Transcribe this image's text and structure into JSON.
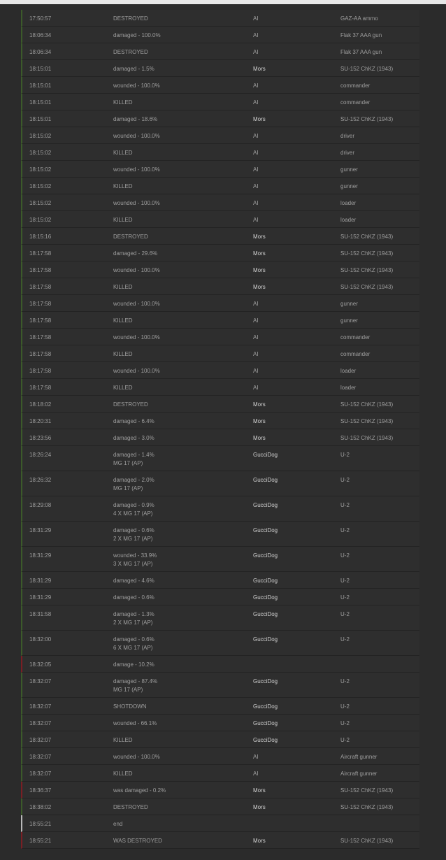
{
  "colors": {
    "background": "#2b2b2b",
    "row": "#2e2e2e",
    "border_ok": "#3c5a2a",
    "border_bad": "#7a1f24",
    "border_end": "#b9b9b9"
  },
  "log": {
    "rows": [
      {
        "time": "17:50:57",
        "event": "DESTROYED",
        "weapon": "",
        "player": "AI",
        "target": "GAZ-AA ammo",
        "marker": "green"
      },
      {
        "time": "18:06:34",
        "event": "damaged - 100.0%",
        "weapon": "",
        "player": "AI",
        "target": "Flak 37 AAA gun",
        "marker": "green"
      },
      {
        "time": "18:06:34",
        "event": "DESTROYED",
        "weapon": "",
        "player": "AI",
        "target": "Flak 37 AAA gun",
        "marker": "green"
      },
      {
        "time": "18:15:01",
        "event": "damaged - 1.5%",
        "weapon": "",
        "player": "Mors",
        "target": "SU-152 ChKZ (1943)",
        "marker": "green"
      },
      {
        "time": "18:15:01",
        "event": "wounded - 100.0%",
        "weapon": "",
        "player": "AI",
        "target": "commander",
        "marker": "green"
      },
      {
        "time": "18:15:01",
        "event": "KILLED",
        "weapon": "",
        "player": "AI",
        "target": "commander",
        "marker": "green"
      },
      {
        "time": "18:15:01",
        "event": "damaged - 18.6%",
        "weapon": "",
        "player": "Mors",
        "target": "SU-152 ChKZ (1943)",
        "marker": "green"
      },
      {
        "time": "18:15:02",
        "event": "wounded - 100.0%",
        "weapon": "",
        "player": "AI",
        "target": "driver",
        "marker": "green"
      },
      {
        "time": "18:15:02",
        "event": "KILLED",
        "weapon": "",
        "player": "AI",
        "target": "driver",
        "marker": "green"
      },
      {
        "time": "18:15:02",
        "event": "wounded - 100.0%",
        "weapon": "",
        "player": "AI",
        "target": "gunner",
        "marker": "green"
      },
      {
        "time": "18:15:02",
        "event": "KILLED",
        "weapon": "",
        "player": "AI",
        "target": "gunner",
        "marker": "green"
      },
      {
        "time": "18:15:02",
        "event": "wounded - 100.0%",
        "weapon": "",
        "player": "AI",
        "target": "loader",
        "marker": "green"
      },
      {
        "time": "18:15:02",
        "event": "KILLED",
        "weapon": "",
        "player": "AI",
        "target": "loader",
        "marker": "green"
      },
      {
        "time": "18:15:16",
        "event": "DESTROYED",
        "weapon": "",
        "player": "Mors",
        "target": "SU-152 ChKZ (1943)",
        "marker": "green"
      },
      {
        "time": "18:17:58",
        "event": "damaged - 29.6%",
        "weapon": "",
        "player": "Mors",
        "target": "SU-152 ChKZ (1943)",
        "marker": "green"
      },
      {
        "time": "18:17:58",
        "event": "wounded - 100.0%",
        "weapon": "",
        "player": "Mors",
        "target": "SU-152 ChKZ (1943)",
        "marker": "green"
      },
      {
        "time": "18:17:58",
        "event": "KILLED",
        "weapon": "",
        "player": "Mors",
        "target": "SU-152 ChKZ (1943)",
        "marker": "green"
      },
      {
        "time": "18:17:58",
        "event": "wounded - 100.0%",
        "weapon": "",
        "player": "AI",
        "target": "gunner",
        "marker": "green"
      },
      {
        "time": "18:17:58",
        "event": "KILLED",
        "weapon": "",
        "player": "AI",
        "target": "gunner",
        "marker": "green"
      },
      {
        "time": "18:17:58",
        "event": "wounded - 100.0%",
        "weapon": "",
        "player": "AI",
        "target": "commander",
        "marker": "green"
      },
      {
        "time": "18:17:58",
        "event": "KILLED",
        "weapon": "",
        "player": "AI",
        "target": "commander",
        "marker": "green"
      },
      {
        "time": "18:17:58",
        "event": "wounded - 100.0%",
        "weapon": "",
        "player": "AI",
        "target": "loader",
        "marker": "green"
      },
      {
        "time": "18:17:58",
        "event": "KILLED",
        "weapon": "",
        "player": "AI",
        "target": "loader",
        "marker": "green"
      },
      {
        "time": "18:18:02",
        "event": "DESTROYED",
        "weapon": "",
        "player": "Mors",
        "target": "SU-152 ChKZ (1943)",
        "marker": "green"
      },
      {
        "time": "18:20:31",
        "event": "damaged - 6.4%",
        "weapon": "",
        "player": "Mors",
        "target": "SU-152 ChKZ (1943)",
        "marker": "green"
      },
      {
        "time": "18:23:56",
        "event": "damaged - 3.0%",
        "weapon": "",
        "player": "Mors",
        "target": "SU-152 ChKZ (1943)",
        "marker": "green"
      },
      {
        "time": "18:26:24",
        "event": "damaged - 1.4%",
        "weapon": "MG 17 (AP)",
        "player": "GucciDog",
        "target": "U-2",
        "marker": "green"
      },
      {
        "time": "18:26:32",
        "event": "damaged - 2.0%",
        "weapon": "MG 17 (AP)",
        "player": "GucciDog",
        "target": "U-2",
        "marker": "green"
      },
      {
        "time": "18:29:08",
        "event": "damaged - 0.9%",
        "weapon": "4 X MG 17 (AP)",
        "player": "GucciDog",
        "target": "U-2",
        "marker": "green"
      },
      {
        "time": "18:31:29",
        "event": "damaged - 0.6%",
        "weapon": "2 X MG 17 (AP)",
        "player": "GucciDog",
        "target": "U-2",
        "marker": "green"
      },
      {
        "time": "18:31:29",
        "event": "wounded - 33.9%",
        "weapon": "3 X MG 17 (AP)",
        "player": "GucciDog",
        "target": "U-2",
        "marker": "green"
      },
      {
        "time": "18:31:29",
        "event": "damaged - 4.6%",
        "weapon": "",
        "player": "GucciDog",
        "target": "U-2",
        "marker": "green"
      },
      {
        "time": "18:31:29",
        "event": "damaged - 0.6%",
        "weapon": "",
        "player": "GucciDog",
        "target": "U-2",
        "marker": "green"
      },
      {
        "time": "18:31:58",
        "event": "damaged - 1.3%",
        "weapon": "2 X MG 17 (AP)",
        "player": "GucciDog",
        "target": "U-2",
        "marker": "green"
      },
      {
        "time": "18:32:00",
        "event": "damaged - 0.6%",
        "weapon": "6 X MG 17 (AP)",
        "player": "GucciDog",
        "target": "U-2",
        "marker": "green"
      },
      {
        "time": "18:32:05",
        "event": "damage - 10.2%",
        "weapon": "",
        "player": "",
        "target": "",
        "marker": "red"
      },
      {
        "time": "18:32:07",
        "event": "damaged - 87.4%",
        "weapon": "MG 17 (AP)",
        "player": "GucciDog",
        "target": "U-2",
        "marker": "green"
      },
      {
        "time": "18:32:07",
        "event": "SHOTDOWN",
        "weapon": "",
        "player": "GucciDog",
        "target": "U-2",
        "marker": "green"
      },
      {
        "time": "18:32:07",
        "event": "wounded - 66.1%",
        "weapon": "",
        "player": "GucciDog",
        "target": "U-2",
        "marker": "green"
      },
      {
        "time": "18:32:07",
        "event": "KILLED",
        "weapon": "",
        "player": "GucciDog",
        "target": "U-2",
        "marker": "green"
      },
      {
        "time": "18:32:07",
        "event": "wounded - 100.0%",
        "weapon": "",
        "player": "AI",
        "target": "Aircraft gunner",
        "marker": "green"
      },
      {
        "time": "18:32:07",
        "event": "KILLED",
        "weapon": "",
        "player": "AI",
        "target": "Aircraft gunner",
        "marker": "green"
      },
      {
        "time": "18:36:37",
        "event": "was damaged - 0.2%",
        "weapon": "",
        "player": "Mors",
        "target": "SU-152 ChKZ (1943)",
        "marker": "red"
      },
      {
        "time": "18:38:02",
        "event": "DESTROYED",
        "weapon": "",
        "player": "Mors",
        "target": "SU-152 ChKZ (1943)",
        "marker": "green"
      },
      {
        "time": "18:55:21",
        "event": "end",
        "weapon": "",
        "player": "",
        "target": "",
        "marker": "white"
      },
      {
        "time": "18:55:21",
        "event": "WAS DESTROYED",
        "weapon": "",
        "player": "Mors",
        "target": "SU-152 ChKZ (1943)",
        "marker": "red"
      }
    ]
  }
}
